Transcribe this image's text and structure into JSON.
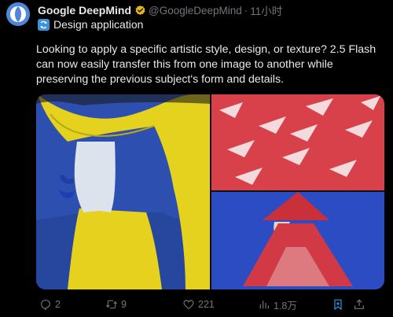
{
  "post": {
    "author_name": "Google DeepMind",
    "handle": "@GoogleDeepMind",
    "separator": "·",
    "time": "11小时",
    "subtitle": "Design application",
    "text": "Looking to apply a specific artistic style, design, or texture? 2.5 Flash can now easily transfer this from one image to another while preserving the previous subject's form and details."
  },
  "actions": {
    "replies": "2",
    "retweets": "9",
    "likes": "221",
    "views": "1.8万"
  },
  "colors": {
    "background": "#000000",
    "text": "#e7e9ea",
    "muted": "#71767b",
    "verified": "#e2b719",
    "bookmark_active": "#1d9bf0",
    "brand_avatar": "#4f86d9"
  },
  "icons": [
    "deepmind-logo-icon",
    "verified-badge-icon",
    "refresh-icon",
    "reply-icon",
    "retweet-icon",
    "like-icon",
    "views-icon",
    "bookmark-icon",
    "share-icon"
  ]
}
